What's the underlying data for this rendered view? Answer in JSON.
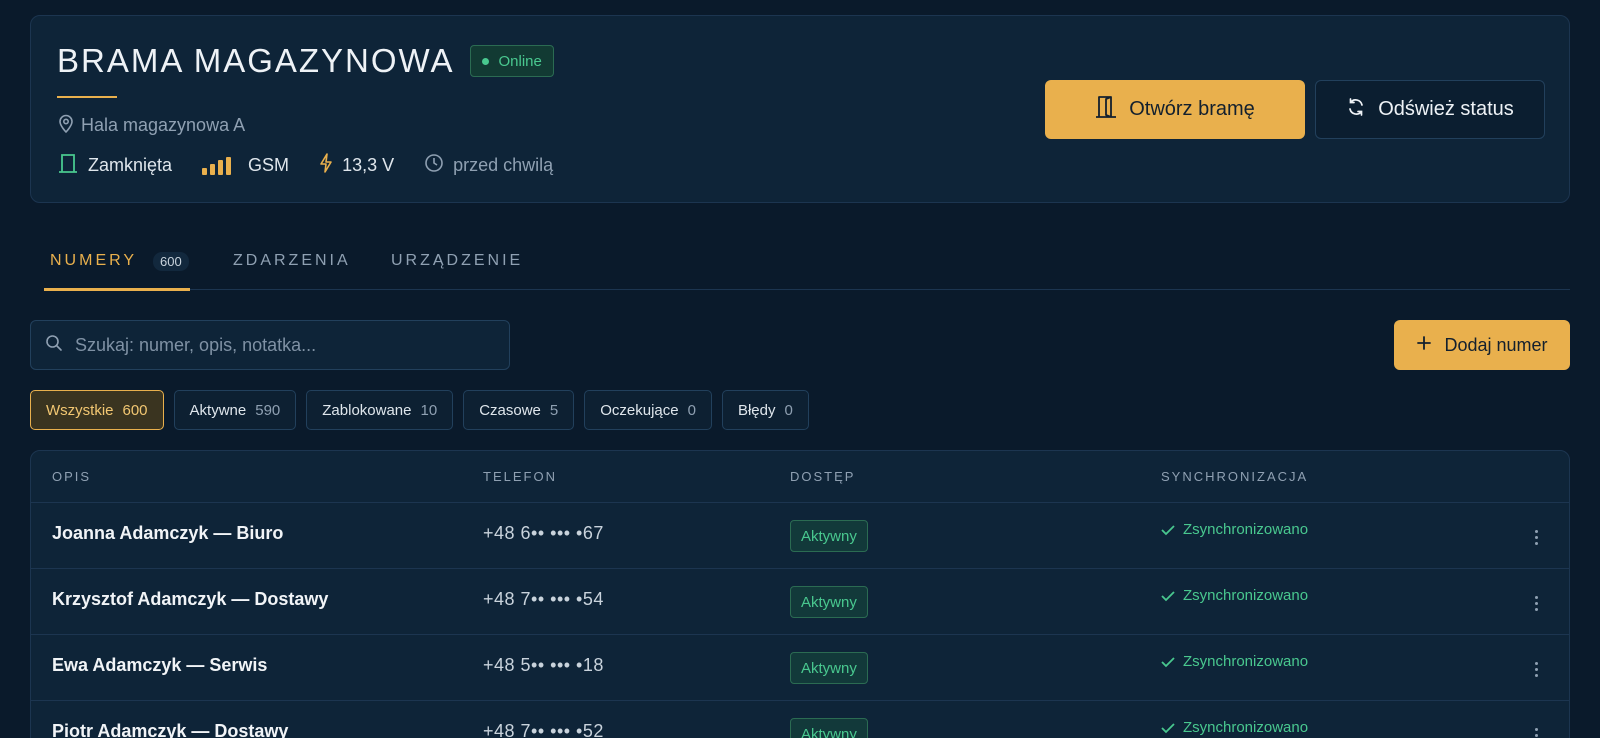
{
  "gate": {
    "title": "BRAMA MAGAZYNOWA",
    "status_badge": "Online",
    "location": "Hala magazynowa A",
    "door_state": "Zamknięta",
    "signal_type": "GSM",
    "voltage": "13,3 V",
    "last_update": "przed chwilą",
    "open_button": "Otwórz bramę",
    "refresh_button": "Odśwież status"
  },
  "tabs": [
    {
      "label": "NUMERY",
      "count": "600",
      "active": true
    },
    {
      "label": "ZDARZENIA"
    },
    {
      "label": "URZĄDZENIE"
    }
  ],
  "search": {
    "placeholder": "Szukaj: numer, opis, notatka..."
  },
  "add_button": "Dodaj numer",
  "filters": [
    {
      "label": "Wszystkie",
      "count": "600",
      "active": true
    },
    {
      "label": "Aktywne",
      "count": "590"
    },
    {
      "label": "Zablokowane",
      "count": "10"
    },
    {
      "label": "Czasowe",
      "count": "5"
    },
    {
      "label": "Oczekujące",
      "count": "0"
    },
    {
      "label": "Błędy",
      "count": "0"
    }
  ],
  "table": {
    "headers": {
      "opis": "OPIS",
      "telefon": "TELEFON",
      "dostep": "DOSTĘP",
      "sync": "SYNCHRONIZACJA"
    },
    "rows": [
      {
        "name": "Joanna Adamczyk — Biuro",
        "phone": "+48 6•• ••• •67",
        "access": "Aktywny",
        "sync": "Zsynchronizowano"
      },
      {
        "name": "Krzysztof Adamczyk — Dostawy",
        "phone": "+48 7•• ••• •54",
        "access": "Aktywny",
        "sync": "Zsynchronizowano"
      },
      {
        "name": "Ewa Adamczyk — Serwis",
        "phone": "+48 5•• ••• •18",
        "access": "Aktywny",
        "sync": "Zsynchronizowano"
      },
      {
        "name": "Piotr Adamczyk — Dostawy",
        "phone": "+48 7•• ••• •52",
        "access": "Aktywny",
        "sync": "Zsynchronizowano"
      }
    ]
  },
  "colors": {
    "accent": "#e9b04d",
    "success": "#49c88f",
    "background": "#0a1a2b",
    "card": "#0e2438"
  }
}
